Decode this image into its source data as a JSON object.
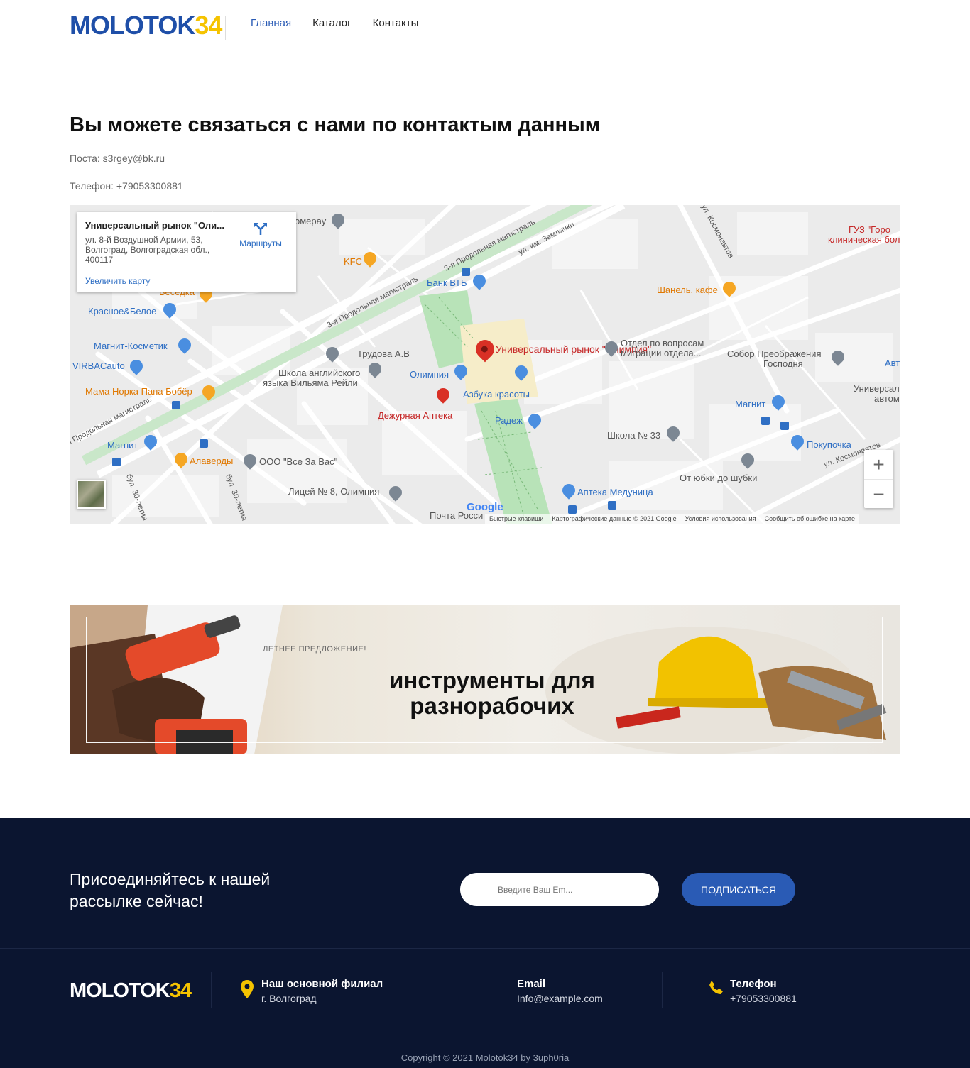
{
  "header": {
    "logo_main": "MOLOTOK",
    "logo_num": "34",
    "nav": [
      {
        "label": "Главная",
        "active": true
      },
      {
        "label": "Каталог",
        "active": false
      },
      {
        "label": "Контакты",
        "active": false
      }
    ]
  },
  "contacts": {
    "title": "Вы можете связаться с нами по контактым данным",
    "mail": "Поста: s3rgey@bk.ru",
    "phone": "Телефон: +79053300881"
  },
  "map": {
    "card_name": "Универсальный рынок \"Оли...",
    "card_address": "ул. 8-й Воздушной Армии, 53, Волгоград, Волгоградская обл., 400117",
    "card_zoom": "Увеличить карту",
    "card_route": "Маршруты",
    "main_label": "Универсальный рынок \"Олимпия\"",
    "google": "Google",
    "footer": [
      "Быстрые клавиши",
      "Картографические данные © 2021 Google",
      "Условия использования",
      "Сообщить об ошибке на карте"
    ],
    "streets": [
      "3-я Продольная магистраль",
      "3-я Продольная магистраль",
      "3-я Продольная магистраль",
      "ул. им. Землячки",
      "ул. Космонавтов",
      "ул. Космонавтов",
      "бул. 30-летия",
      "бул. 30-летия"
    ],
    "pois": [
      {
        "label": "Мегамаркер",
        "color": "gray",
        "partial": "омерау"
      },
      {
        "label": "KFC",
        "color": "orange"
      },
      {
        "label": "Банк ВТБ",
        "color": "blue"
      },
      {
        "label": "ГУЗ \"Городская клиническая больница\"",
        "color": "red",
        "line1": "ГУЗ \"Горо",
        "line2": "клиническая боль"
      },
      {
        "label": "Шанель, кафе",
        "color": "orange"
      },
      {
        "label": "Беседка",
        "color": "orange"
      },
      {
        "label": "Красное&Белое",
        "color": "blue"
      },
      {
        "label": "Магнит-Косметик",
        "color": "blue"
      },
      {
        "label": "VIRBACauto",
        "color": "blue"
      },
      {
        "label": "Мама Норка Папа Бобёр",
        "color": "orange"
      },
      {
        "label": "Трудова А.В",
        "color": "gray"
      },
      {
        "label": "Школа английского языка Вильяма Рейли",
        "color": "gray",
        "line1": "Школа английского",
        "line2": "языка Вильяма Рейли"
      },
      {
        "label": "Олимпия",
        "color": "blue"
      },
      {
        "label": "Азбука красоты",
        "color": "blue"
      },
      {
        "label": "Дежурная Аптека",
        "color": "red"
      },
      {
        "label": "Радеж",
        "color": "blue"
      },
      {
        "label": "Отдел по вопросам миграции отдела...",
        "color": "gray",
        "line1": "Отдел по вопросам",
        "line2": "миграции отдела..."
      },
      {
        "label": "Собор Преображения Господня",
        "color": "gray",
        "line1": "Собор Преображения",
        "line2": "Господня"
      },
      {
        "label": "Авто",
        "color": "blue",
        "partial": "Авт"
      },
      {
        "label": "Универсальный автомобильный",
        "color": "gray",
        "line1": "Универсал",
        "line2": "автом"
      },
      {
        "label": "Магнит",
        "color": "blue"
      },
      {
        "label": "Покупочка",
        "color": "blue"
      },
      {
        "label": "Школа № 33",
        "color": "gray"
      },
      {
        "label": "Магнит",
        "color": "blue"
      },
      {
        "label": "Алаверды",
        "color": "orange"
      },
      {
        "label": "ООО \"Все За Вас\"",
        "color": "gray"
      },
      {
        "label": "От юбки до шубки",
        "color": "gray"
      },
      {
        "label": "Лицей № 8, Олимпия",
        "color": "gray"
      },
      {
        "label": "Аптека Медуница",
        "color": "blue"
      },
      {
        "label": "Почта России",
        "color": "gray",
        "partial": "Почта Росси"
      }
    ]
  },
  "banner": {
    "kicker": "ЛЕТНЕЕ ПРЕДЛОЖЕНИЕ!",
    "headline": "инструменты для разнорабочих"
  },
  "newsletter": {
    "title": "Присоединяйтесь к нашей рассылке сейчас!",
    "placeholder": "Введите Ваш Em...",
    "button": "ПОДПИСАТЬСЯ"
  },
  "footer": {
    "logo_main": "MOLOTOK",
    "logo_num": "34",
    "branch_title": "Наш основной филиал",
    "branch_value": "г. Волгоград",
    "email_title": "Email",
    "email_value": "Info@example.com",
    "phone_title": "Телефон",
    "phone_value": "+79053300881",
    "copyright": "Copyright © 2021 Molotok34 by 3uph0ria"
  },
  "colors": {
    "brand_blue": "#1f4fa8",
    "brand_yellow": "#f5c300",
    "footer_bg": "#0b1530",
    "button_blue": "#2a5bb5"
  }
}
